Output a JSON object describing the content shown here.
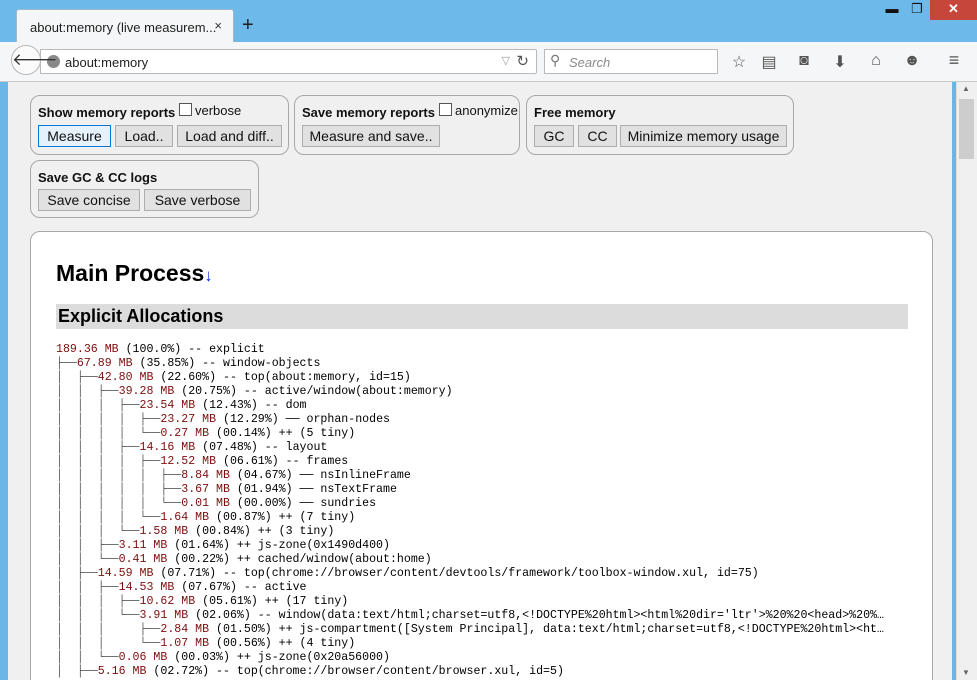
{
  "window": {
    "tab_title": "about:memory (live measurem...",
    "tab_close": "×",
    "new_tab": "+",
    "minimize": "▬",
    "maximize": "❐",
    "close": "✕"
  },
  "navbar": {
    "back_icon": "arrow-left",
    "url": "about:memory",
    "url_dropdown": "▽",
    "reload": "↻",
    "search_placeholder": "Search",
    "toolbar_icons": [
      "star-icon",
      "reading-list-icon",
      "pocket-icon",
      "download-icon",
      "home-icon",
      "smiley-icon",
      "menu-icon"
    ]
  },
  "controls": {
    "show": {
      "title": "Show memory reports",
      "verbose_label": "verbose",
      "measure": "Measure",
      "load": "Load..",
      "load_diff": "Load and diff.."
    },
    "save": {
      "title": "Save memory reports",
      "anonymize_label": "anonymize",
      "measure_save": "Measure and save.."
    },
    "free": {
      "title": "Free memory",
      "gc": "GC",
      "cc": "CC",
      "minimize": "Minimize memory usage"
    },
    "logs": {
      "title": "Save GC & CC logs",
      "concise": "Save concise",
      "verbose": "Save verbose"
    }
  },
  "report": {
    "process_title": "Main Process",
    "process_arrow": "↓",
    "section": "Explicit Allocations",
    "rows": [
      {
        "prefix": "",
        "size": "189.36 MB",
        "rest": " (100.0%) -- explicit"
      },
      {
        "prefix": "├──",
        "size": "67.89 MB",
        "rest": " (35.85%) -- window-objects"
      },
      {
        "prefix": "│  ├──",
        "size": "42.80 MB",
        "rest": " (22.60%) -- top(about:memory, id=15)"
      },
      {
        "prefix": "│  │  ├──",
        "size": "39.28 MB",
        "rest": " (20.75%) -- active/window(about:memory)"
      },
      {
        "prefix": "│  │  │  ├──",
        "size": "23.54 MB",
        "rest": " (12.43%) -- dom"
      },
      {
        "prefix": "│  │  │  │  ├──",
        "size": "23.27 MB",
        "rest": " (12.29%) ── orphan-nodes"
      },
      {
        "prefix": "│  │  │  │  └──",
        "size": "0.27 MB",
        "rest": " (00.14%) ++ (5 tiny)"
      },
      {
        "prefix": "│  │  │  ├──",
        "size": "14.16 MB",
        "rest": " (07.48%) -- layout"
      },
      {
        "prefix": "│  │  │  │  ├──",
        "size": "12.52 MB",
        "rest": " (06.61%) -- frames"
      },
      {
        "prefix": "│  │  │  │  │  ├──",
        "size": "8.84 MB",
        "rest": " (04.67%) ── nsInlineFrame"
      },
      {
        "prefix": "│  │  │  │  │  ├──",
        "size": "3.67 MB",
        "rest": " (01.94%) ── nsTextFrame"
      },
      {
        "prefix": "│  │  │  │  │  └──",
        "size": "0.01 MB",
        "rest": " (00.00%) ── sundries"
      },
      {
        "prefix": "│  │  │  │  └──",
        "size": "1.64 MB",
        "rest": " (00.87%) ++ (7 tiny)"
      },
      {
        "prefix": "│  │  │  └──",
        "size": "1.58 MB",
        "rest": " (00.84%) ++ (3 tiny)"
      },
      {
        "prefix": "│  │  ├──",
        "size": "3.11 MB",
        "rest": " (01.64%) ++ js-zone(0x1490d400)"
      },
      {
        "prefix": "│  │  └──",
        "size": "0.41 MB",
        "rest": " (00.22%) ++ cached/window(about:home)"
      },
      {
        "prefix": "│  ├──",
        "size": "14.59 MB",
        "rest": " (07.71%) -- top(chrome://browser/content/devtools/framework/toolbox-window.xul, id=75)"
      },
      {
        "prefix": "│  │  ├──",
        "size": "14.53 MB",
        "rest": " (07.67%) -- active"
      },
      {
        "prefix": "│  │  │  ├──",
        "size": "10.62 MB",
        "rest": " (05.61%) ++ (17 tiny)"
      },
      {
        "prefix": "│  │  │  └──",
        "size": "3.91 MB",
        "rest": " (02.06%) -- window(data:text/html;charset=utf8,<!DOCTYPE%20html><html%20dir='ltr'>%20%20<head>%20%…"
      },
      {
        "prefix": "│  │  │     ├──",
        "size": "2.84 MB",
        "rest": " (01.50%) ++ js-compartment([System Principal], data:text/html;charset=utf8,<!DOCTYPE%20html><ht…"
      },
      {
        "prefix": "│  │  │     └──",
        "size": "1.07 MB",
        "rest": " (00.56%) ++ (4 tiny)"
      },
      {
        "prefix": "│  │  └──",
        "size": "0.06 MB",
        "rest": " (00.03%) ++ js-zone(0x20a56000)"
      },
      {
        "prefix": "│  ├──",
        "size": "5.16 MB",
        "rest": " (02.72%) -- top(chrome://browser/content/browser.xul, id=5)"
      }
    ]
  }
}
